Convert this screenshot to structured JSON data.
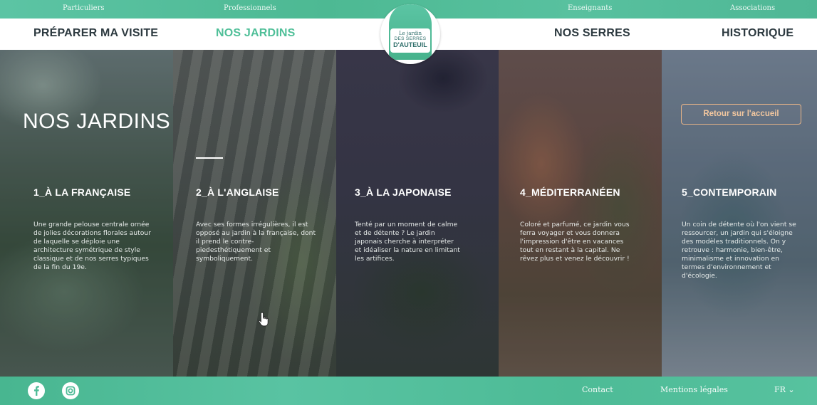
{
  "topbar": {
    "links": [
      "Particuliers",
      "Professionnels",
      "Enseignants",
      "Associations"
    ]
  },
  "nav": {
    "left": [
      "PRÉPARER MA VISITE",
      "NOS JARDINS"
    ],
    "right": [
      "NOS SERRES",
      "HISTORIQUE"
    ],
    "active": "NOS JARDINS"
  },
  "logo": {
    "line1": "Le jardin",
    "line2": "DES SERRES",
    "line3": "D'AUTEUIL"
  },
  "page": {
    "title": "NOS JARDINS",
    "home_button": "Retour sur l'accueil"
  },
  "gardens": [
    {
      "title": "1_À LA FRANÇAISE",
      "description": "Une grande pelouse centrale ornée de jolies décorations florales autour de laquelle se déploie une architecture symétrique de style classique et de nos serres typiques de la fin du 19e."
    },
    {
      "title": "2_À L'ANGLAISE",
      "description": "Avec ses formes irrégulières, il est opposé au jardin à la française, dont il prend le contre-piedesthétiquement et symboliquement."
    },
    {
      "title": "3_À LA JAPONAISE",
      "description": "Tenté par un moment de calme et de détente ? Le jardin japonais cherche à interpréter et idéaliser la nature en limitant les artifices."
    },
    {
      "title": "4_MÉDITERRANÉEN",
      "description": "Coloré et parfumé, ce jardin vous ferra voyager et vous donnera l'impression d'être en vacances tout en restant à la capital. Ne rêvez plus et venez le découvrir !"
    },
    {
      "title": "5_CONTEMPORAIN",
      "description": "Un coin de détente où l'on vient se ressourcer, un jardin qui s'éloigne des modèles traditionnels. On y retrouve : harmonie, bien-être, minimalisme et innovation en termes d'environnement et d'écologie."
    }
  ],
  "footer": {
    "contact": "Contact",
    "legal": "Mentions légales",
    "language": "FR ⌄"
  },
  "colors": {
    "brand_green": "#4fbf98",
    "nav_text": "#2d3a40",
    "home_button_border": "#e7b487"
  },
  "icons": [
    "facebook-icon",
    "instagram-icon",
    "hand-cursor-icon",
    "dome-logo-icon"
  ]
}
